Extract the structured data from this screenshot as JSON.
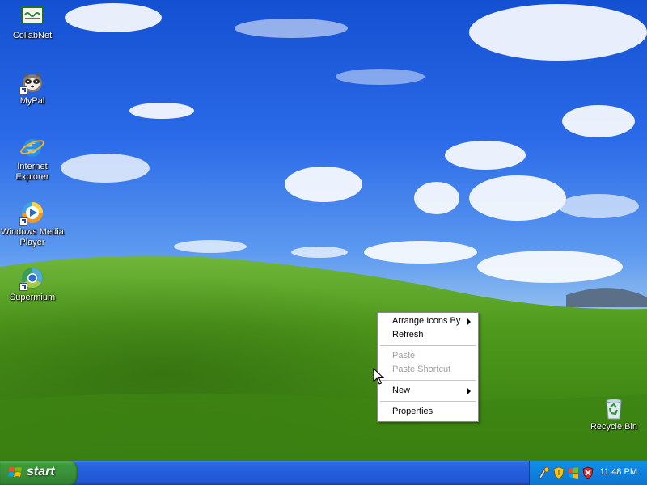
{
  "desktop": {
    "icons": [
      {
        "label": "CollabNet",
        "icon": "collabnet-icon"
      },
      {
        "label": "MyPal",
        "icon": "mypal-icon"
      },
      {
        "label": "Internet Explorer",
        "icon": "internet-explorer-icon"
      },
      {
        "label": "Windows Media Player",
        "icon": "windows-media-player-icon"
      },
      {
        "label": "Supermium",
        "icon": "supermium-icon"
      },
      {
        "label": "Recycle Bin",
        "icon": "recycle-bin-icon"
      }
    ]
  },
  "context_menu": {
    "items": [
      {
        "label": "Arrange Icons By",
        "submenu": true,
        "enabled": true
      },
      {
        "label": "Refresh",
        "submenu": false,
        "enabled": true
      },
      {
        "label": "Paste",
        "submenu": false,
        "enabled": false
      },
      {
        "label": "Paste Shortcut",
        "submenu": false,
        "enabled": false
      },
      {
        "label": "New",
        "submenu": true,
        "enabled": true
      },
      {
        "label": "Properties",
        "submenu": false,
        "enabled": true
      }
    ]
  },
  "taskbar": {
    "start_label": "start",
    "tray_icons": [
      "network-tools-icon",
      "security-shield-icon",
      "windows-update-icon",
      "antivirus-shield-icon"
    ],
    "clock": "11:48 PM"
  },
  "colors": {
    "taskbar_blue": "#245edb",
    "start_green": "#3c9b3c",
    "tray_blue": "#0e84e0",
    "sky_blue": "#2d6fe8",
    "grass_green": "#4f9a1c"
  }
}
